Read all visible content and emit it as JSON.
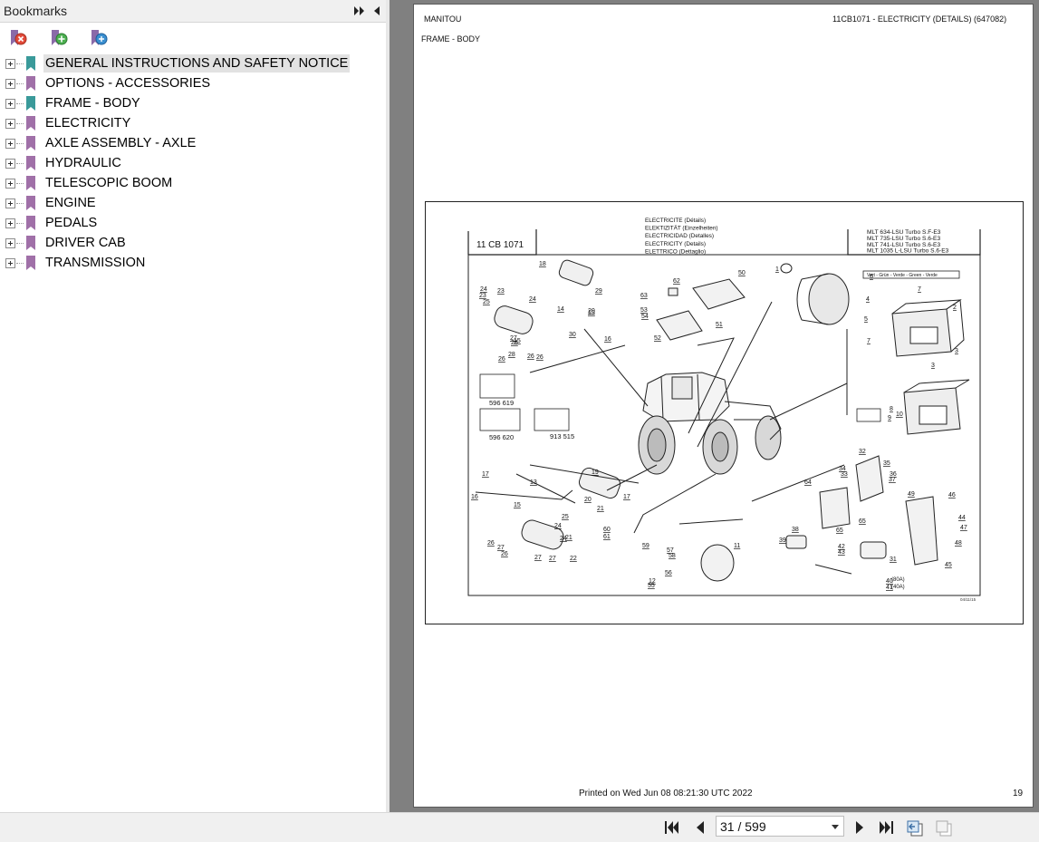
{
  "bookmarks_panel": {
    "title": "Bookmarks",
    "toolbar": [
      "remove-bookmark-icon",
      "add-bookmark-icon",
      "find-bookmark-icon"
    ],
    "items": [
      {
        "label": "GENERAL INSTRUCTIONS AND SAFETY NOTICE",
        "selected": true,
        "icon_color": "#3a9a9a"
      },
      {
        "label": "OPTIONS - ACCESSORIES",
        "icon_color": "#a070a8"
      },
      {
        "label": "FRAME - BODY",
        "icon_color": "#3a9a9a"
      },
      {
        "label": "ELECTRICITY",
        "icon_color": "#a070a8"
      },
      {
        "label": "AXLE ASSEMBLY - AXLE",
        "icon_color": "#a070a8"
      },
      {
        "label": "HYDRAULIC",
        "icon_color": "#a070a8"
      },
      {
        "label": "TELESCOPIC BOOM",
        "icon_color": "#a070a8"
      },
      {
        "label": "ENGINE",
        "icon_color": "#a070a8"
      },
      {
        "label": "PEDALS",
        "icon_color": "#a070a8"
      },
      {
        "label": "DRIVER CAB",
        "icon_color": "#a070a8"
      },
      {
        "label": "TRANSMISSION",
        "icon_color": "#a070a8"
      }
    ]
  },
  "page": {
    "header_left": "MANITOU",
    "header_right": "11CB1071 - ELECTRICITY (DETAILS) (647082)",
    "section": "FRAME - BODY",
    "footer_printed": "Printed on   Wed Jun 08 08:21:30 UTC 2022",
    "page_number": "19",
    "drawing": {
      "code": "11 CB 1071",
      "titles": [
        "ELECTRICITE (Détails)",
        "ELEKTIZITÄT (Einzelheiten)",
        "ELECTRICIDAD (Detalles)",
        "ELECTRICITY (Details)",
        "ELETTRICO (Dettaglio)"
      ],
      "models": [
        "MLT 634-LSU Turbo S.F-E3",
        "MLT 735-LSU Turbo S.6-E3",
        "MLT 741-LSU Turbo S.6-E3",
        "MLT 1035 L-LSU Turbo S.6-E3"
      ],
      "note_left_1": "596 619",
      "note_left_2": "596 620",
      "note_right": "913 515",
      "color_note": "Vert - Grün - Verde - Green - Verde",
      "fuse_80": "(80A)",
      "fuse_40": "(40A)",
      "date": "04/11/15",
      "callouts": [
        "1",
        "2",
        "3",
        "3",
        "4",
        "5",
        "6",
        "7",
        "7",
        "8",
        "9",
        "10",
        "11",
        "12",
        "13",
        "14",
        "15",
        "15",
        "16",
        "16",
        "17",
        "17",
        "18",
        "19",
        "19",
        "20",
        "20",
        "21",
        "21",
        "22",
        "23",
        "23",
        "24",
        "24",
        "24",
        "24",
        "25",
        "25",
        "26",
        "26",
        "26",
        "26",
        "26",
        "26",
        "27",
        "27",
        "27",
        "27",
        "28",
        "29",
        "30",
        "31",
        "32",
        "33",
        "34",
        "35",
        "36",
        "37",
        "38",
        "39",
        "40",
        "41",
        "42",
        "43",
        "44",
        "45",
        "46",
        "47",
        "48",
        "49",
        "50",
        "51",
        "52",
        "53",
        "54",
        "55",
        "56",
        "57",
        "58",
        "59",
        "60",
        "61",
        "62",
        "63",
        "64",
        "65",
        "65"
      ]
    }
  },
  "navigation": {
    "page_indicator": "31 / 599"
  }
}
